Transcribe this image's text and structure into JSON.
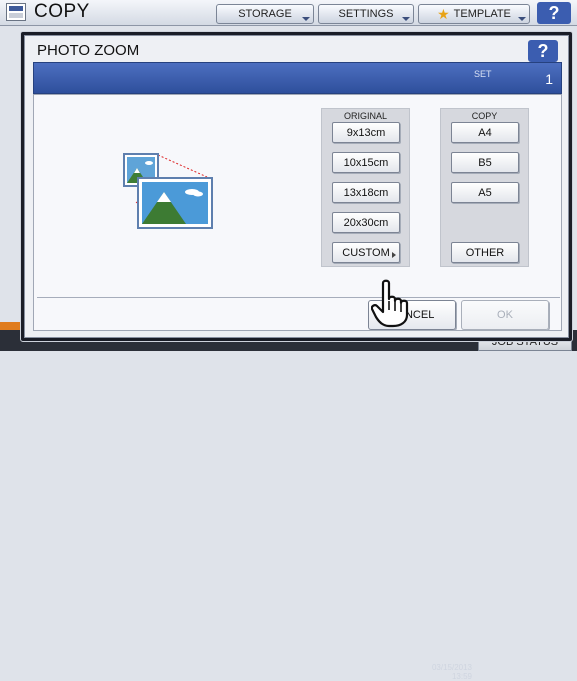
{
  "app": {
    "title": "COPY",
    "tabs": [
      {
        "label": "STORAGE"
      },
      {
        "label": "SETTINGS"
      },
      {
        "label": "TEMPLATE"
      }
    ],
    "help_label": "?",
    "clock_line1": "03/15/2013",
    "clock_line2": "13:59",
    "job_status_label": "JOB STATUS"
  },
  "dialog": {
    "title": "PHOTO ZOOM",
    "help_label": "?",
    "set_label": "SET",
    "set_value": "1",
    "original": {
      "header": "ORIGINAL",
      "buttons": [
        "9x13cm",
        "10x15cm",
        "13x18cm",
        "20x30cm",
        "CUSTOM"
      ]
    },
    "copy": {
      "header": "COPY",
      "buttons": [
        "A4",
        "B5",
        "A5",
        "OTHER"
      ]
    },
    "cancel_label": "CANCEL",
    "ok_label": "OK"
  },
  "colors": {
    "accent_blue": "#3b5db0",
    "title_bar": "#2e4f9c",
    "status_orange": "#e07c1d"
  }
}
